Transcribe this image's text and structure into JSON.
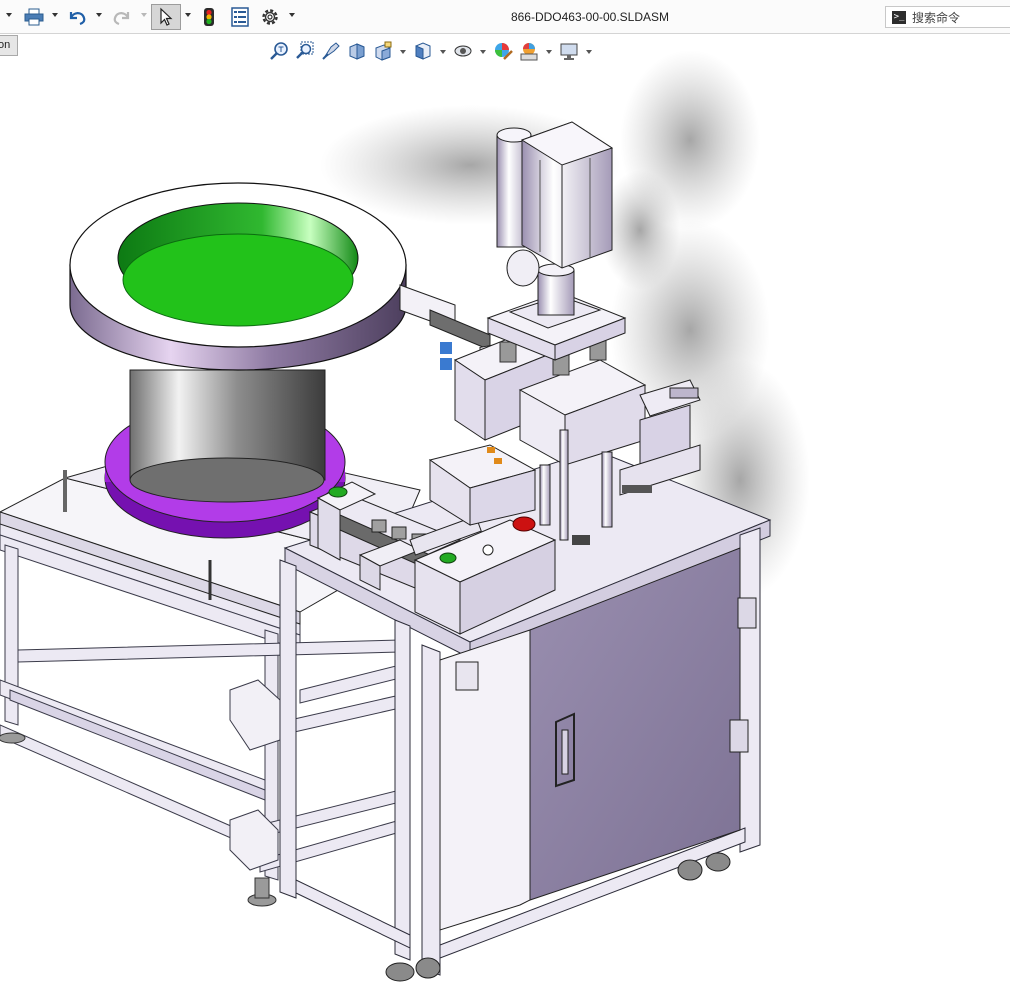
{
  "window": {
    "title": "866-DDO463-00-00.SLDASM"
  },
  "search": {
    "placeholder": "搜索命令"
  },
  "side_tab": {
    "label": "on"
  },
  "icons": {
    "toolbar": [
      "print-icon",
      "undo-icon",
      "redo-icon",
      "select-icon",
      "rebuild-icon",
      "file-properties-icon",
      "options-icon"
    ],
    "heads_up": [
      "zoom-to-fit-icon",
      "zoom-to-area-icon",
      "previous-view-icon",
      "section-view-icon",
      "dynamic-annotation-icon",
      "view-orientation-icon",
      "display-style-icon",
      "hide-show-icon",
      "edit-appearance-icon",
      "apply-scene-icon",
      "view-settings-icon"
    ]
  },
  "colors": {
    "bowl_inner": "#22c21a",
    "bowl_outer": "#9a8aab",
    "base_ring": "#9b1fd6",
    "frame": "#ece9f3",
    "cabinet": "#8f84a5",
    "button_green": "#22aa22",
    "button_red": "#cc1111"
  }
}
